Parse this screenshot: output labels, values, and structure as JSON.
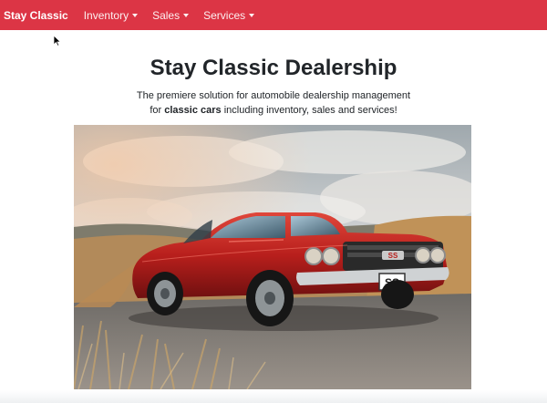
{
  "navbar": {
    "brand": "Stay Classic",
    "items": [
      {
        "label": "Inventory"
      },
      {
        "label": "Sales"
      },
      {
        "label": "Services"
      }
    ],
    "color": "#dc3545"
  },
  "hero": {
    "title": "Stay Classic Dealership",
    "lead_line1": "The premiere solution for automobile dealership management",
    "lead_line2_prefix": "for ",
    "lead_line2_bold": "classic cars",
    "lead_line2_suffix": " including inventory, sales and services!",
    "image": {
      "plate_text": "SS",
      "badge_text": "SS"
    }
  }
}
